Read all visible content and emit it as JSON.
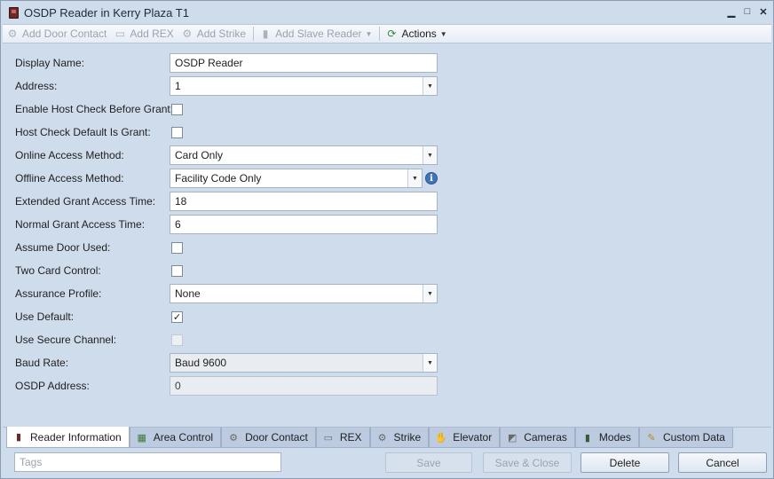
{
  "window": {
    "title": "OSDP Reader in Kerry Plaza T1",
    "controls": [
      "minimize-icon",
      "maximize-icon",
      "close-icon"
    ]
  },
  "toolbar": {
    "add_door_contact": "Add Door Contact",
    "add_rex": "Add REX",
    "add_strike": "Add Strike",
    "add_slave_reader": "Add Slave Reader",
    "actions": "Actions"
  },
  "form": {
    "display_name": {
      "label": "Display Name:",
      "value": "OSDP Reader"
    },
    "address": {
      "label": "Address:",
      "value": "1"
    },
    "enable_host_check": {
      "label": "Enable Host Check Before Grant:",
      "checked": false
    },
    "host_check_default": {
      "label": "Host Check Default Is Grant:",
      "checked": false
    },
    "online_access": {
      "label": "Online Access Method:",
      "value": "Card Only"
    },
    "offline_access": {
      "label": "Offline Access Method:",
      "value": "Facility Code Only"
    },
    "extended_grant": {
      "label": "Extended Grant Access Time:",
      "value": "18"
    },
    "normal_grant": {
      "label": "Normal Grant Access Time:",
      "value": "6"
    },
    "assume_door_used": {
      "label": "Assume Door Used:",
      "checked": false
    },
    "two_card_control": {
      "label": "Two Card Control:",
      "checked": false
    },
    "assurance_profile": {
      "label": "Assurance Profile:",
      "value": "None"
    },
    "use_default": {
      "label": "Use Default:",
      "checked": true,
      "mark": "✓"
    },
    "use_secure_channel": {
      "label": "Use Secure Channel:",
      "checked": false
    },
    "baud_rate": {
      "label": "Baud Rate:",
      "value": "Baud 9600"
    },
    "osdp_address": {
      "label": "OSDP Address:",
      "value": "0"
    }
  },
  "tabs": [
    {
      "label": "Reader Information",
      "active": true
    },
    {
      "label": "Area Control"
    },
    {
      "label": "Door Contact"
    },
    {
      "label": "REX"
    },
    {
      "label": "Strike"
    },
    {
      "label": "Elevator"
    },
    {
      "label": "Cameras"
    },
    {
      "label": "Modes"
    },
    {
      "label": "Custom Data"
    }
  ],
  "footer": {
    "tags_placeholder": "Tags",
    "save": "Save",
    "save_close": "Save & Close",
    "delete": "Delete",
    "cancel": "Cancel"
  },
  "colors": {
    "window_bg": "#cfdcec",
    "info_icon": "#3e74b9"
  }
}
